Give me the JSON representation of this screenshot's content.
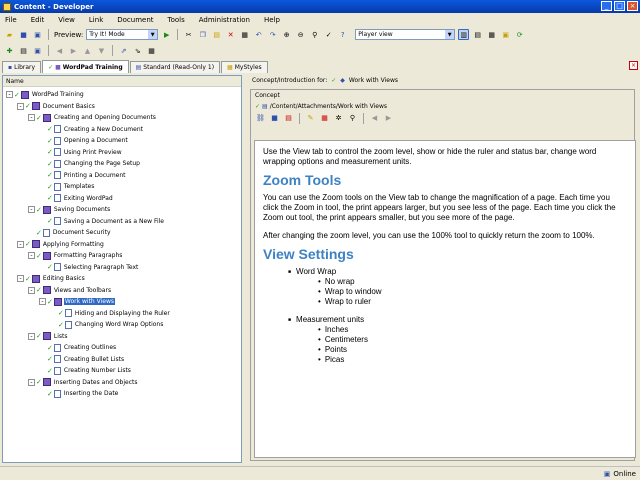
{
  "window": {
    "title": "Content - Developer"
  },
  "menu": [
    "File",
    "Edit",
    "View",
    "Link",
    "Document",
    "Tools",
    "Administration",
    "Help"
  ],
  "toolbar": {
    "preview_label": "Preview:",
    "preview_value": "Try It! Mode",
    "player_value": "Player view"
  },
  "tabs": [
    {
      "label": "Library"
    },
    {
      "label": "WordPad Training"
    },
    {
      "label": "Standard (Read-Only 1)"
    },
    {
      "label": "MyStyles"
    }
  ],
  "tree": {
    "header": "Name",
    "items": [
      {
        "label": "WordPad Training",
        "lvl": 0,
        "type": "book",
        "exp": "-"
      },
      {
        "label": "Document Basics",
        "lvl": 1,
        "type": "book",
        "exp": "-"
      },
      {
        "label": "Creating and Opening Documents",
        "lvl": 2,
        "type": "book",
        "exp": "-"
      },
      {
        "label": "Creating a New Document",
        "lvl": 3,
        "type": "page"
      },
      {
        "label": "Opening a Document",
        "lvl": 3,
        "type": "page"
      },
      {
        "label": "Using Print Preview",
        "lvl": 3,
        "type": "page"
      },
      {
        "label": "Changing the Page Setup",
        "lvl": 3,
        "type": "page"
      },
      {
        "label": "Printing a Document",
        "lvl": 3,
        "type": "page"
      },
      {
        "label": "Templates",
        "lvl": 3,
        "type": "page"
      },
      {
        "label": "Exiting WordPad",
        "lvl": 3,
        "type": "page"
      },
      {
        "label": "Saving Documents",
        "lvl": 2,
        "type": "book",
        "exp": "-"
      },
      {
        "label": "Saving a Document as a New File",
        "lvl": 3,
        "type": "page"
      },
      {
        "label": "Document Security",
        "lvl": 2,
        "type": "page"
      },
      {
        "label": "Applying Formatting",
        "lvl": 1,
        "type": "book",
        "exp": "-"
      },
      {
        "label": "Formatting Paragraphs",
        "lvl": 2,
        "type": "book",
        "exp": "-"
      },
      {
        "label": "Selecting Paragraph Text",
        "lvl": 3,
        "type": "page"
      },
      {
        "label": "Editing Basics",
        "lvl": 1,
        "type": "book",
        "exp": "-"
      },
      {
        "label": "Views and Toolbars",
        "lvl": 2,
        "type": "book",
        "exp": "-"
      },
      {
        "label": "Work with Views",
        "lvl": 3,
        "type": "book",
        "exp": "-",
        "selected": true
      },
      {
        "label": "Hiding and Displaying the Ruler",
        "lvl": 4,
        "type": "page"
      },
      {
        "label": "Changing Word Wrap Options",
        "lvl": 4,
        "type": "page"
      },
      {
        "label": "Lists",
        "lvl": 2,
        "type": "book",
        "exp": "-"
      },
      {
        "label": "Creating Outlines",
        "lvl": 3,
        "type": "page"
      },
      {
        "label": "Creating Bullet Lists",
        "lvl": 3,
        "type": "page"
      },
      {
        "label": "Creating Number Lists",
        "lvl": 3,
        "type": "page"
      },
      {
        "label": "Inserting Dates and Objects",
        "lvl": 2,
        "type": "book",
        "exp": "-"
      },
      {
        "label": "Inserting the Date",
        "lvl": 3,
        "type": "page"
      }
    ]
  },
  "right": {
    "intro_label": "Concept/Introduction for:",
    "intro_value": "Work with Views",
    "concept_label": "Concept",
    "path": "/Content/Attachments/Work with Views"
  },
  "doc": {
    "p1": "Use the View tab to control the zoom level, show or hide the ruler and status bar, change word wrapping options and measurement units.",
    "h1": "Zoom Tools",
    "p2": "You can use the Zoom tools on the View tab to change the magnification of a page. Each time you click the Zoom in tool, the print appears larger, but you see less of the page. Each time you click the Zoom out tool, the print appears smaller, but you see more of the page.",
    "p3": "After changing the zoom level, you can use the 100% tool to quickly return the zoom to 100%.",
    "h2": "View Settings",
    "ww": "Word Wrap",
    "ww_items": [
      "No wrap",
      "Wrap to window",
      "Wrap to ruler"
    ],
    "mu": "Measurement units",
    "mu_items": [
      "Inches",
      "Centimeters",
      "Points",
      "Picas"
    ]
  },
  "status": {
    "text": "Online"
  }
}
